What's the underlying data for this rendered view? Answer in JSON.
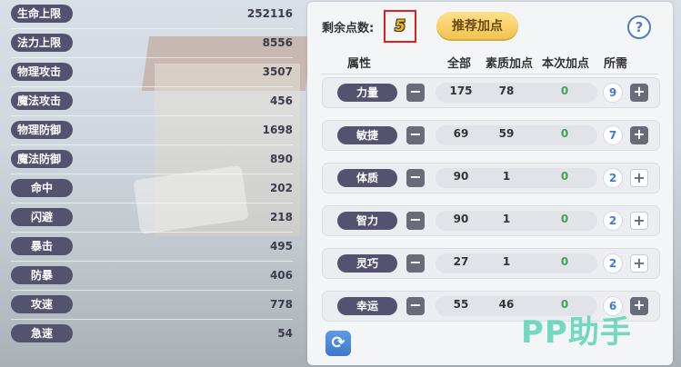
{
  "stats": [
    {
      "label": "生命上限",
      "value": "252116"
    },
    {
      "label": "法力上限",
      "value": "8556"
    },
    {
      "label": "物理攻击",
      "value": "3507"
    },
    {
      "label": "魔法攻击",
      "value": "456"
    },
    {
      "label": "物理防御",
      "value": "1698"
    },
    {
      "label": "魔法防御",
      "value": "890"
    },
    {
      "label": "命中",
      "value": "202"
    },
    {
      "label": "闪避",
      "value": "218"
    },
    {
      "label": "暴击",
      "value": "495"
    },
    {
      "label": "防暴",
      "value": "406"
    },
    {
      "label": "攻速",
      "value": "778"
    },
    {
      "label": "急速",
      "value": "54"
    }
  ],
  "panel": {
    "points_label": "剩余点数:",
    "points_value": "5",
    "recommend_label": "推荐加点",
    "help_icon": "?",
    "headers": {
      "attr": "属性",
      "total": "全部",
      "base": "素质加点",
      "add": "本次加点",
      "cost": "所需"
    },
    "attributes": [
      {
        "name": "力量",
        "total": "175",
        "base": "78",
        "add": "0",
        "cost": "9",
        "plus_style": "dark"
      },
      {
        "name": "敏捷",
        "total": "69",
        "base": "59",
        "add": "0",
        "cost": "7",
        "plus_style": "dark"
      },
      {
        "name": "体质",
        "total": "90",
        "base": "1",
        "add": "0",
        "cost": "2",
        "plus_style": "light"
      },
      {
        "name": "智力",
        "total": "90",
        "base": "1",
        "add": "0",
        "cost": "2",
        "plus_style": "light"
      },
      {
        "name": "灵巧",
        "total": "27",
        "base": "1",
        "add": "0",
        "cost": "2",
        "plus_style": "light"
      },
      {
        "name": "幸运",
        "total": "55",
        "base": "46",
        "add": "0",
        "cost": "6",
        "plus_style": "dark"
      }
    ],
    "minus_glyph": "−",
    "plus_glyph": "+",
    "refresh_glyph": "⟳"
  },
  "watermark": "PP助手",
  "colors": {
    "label_bg": "#535370",
    "accent_blue": "#3d7bd9",
    "accent_green": "#3aa84b",
    "highlight_red": "#e0201b",
    "gold": "#f4b400"
  }
}
